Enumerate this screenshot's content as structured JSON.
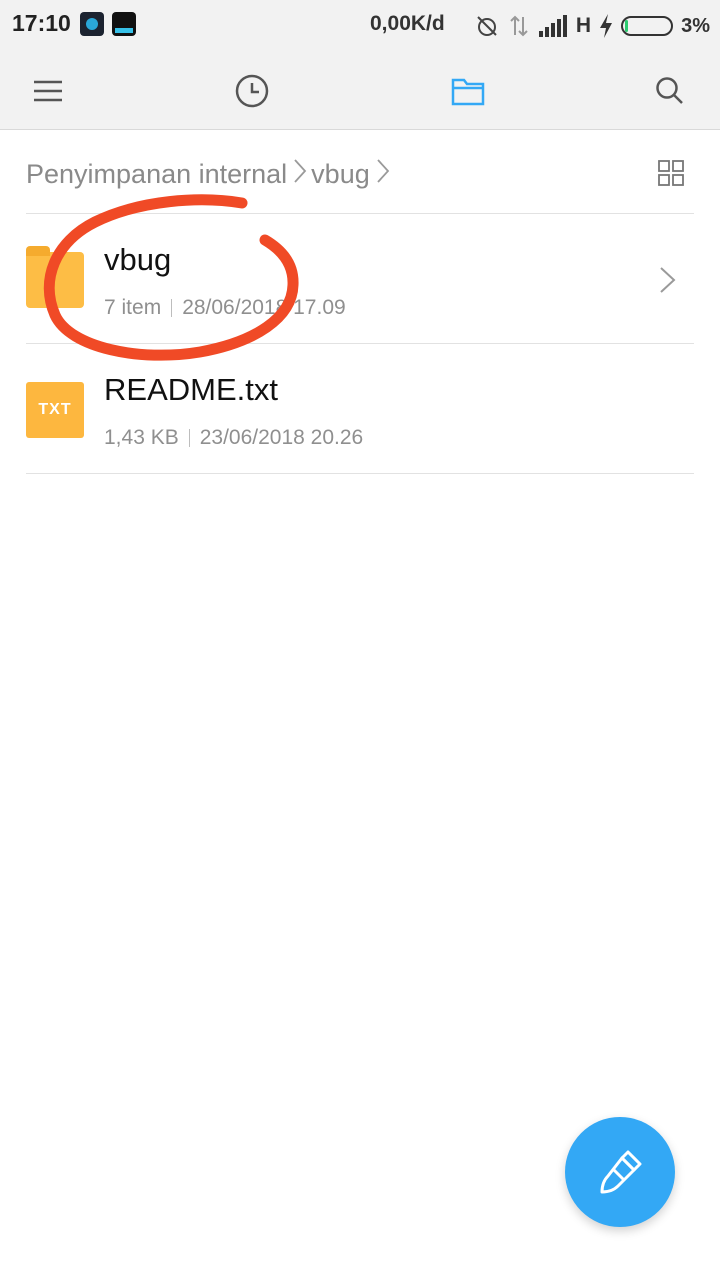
{
  "status_bar": {
    "time": "17:10",
    "network_speed": "0,00K/d",
    "network_type": "H",
    "battery_percent": "3%",
    "battery_level": 0.03,
    "icons": [
      "app-notification-icon",
      "app-notification-icon",
      "alarm-off-icon",
      "data-transfer-icon",
      "signal-icon",
      "charging-icon",
      "battery-icon"
    ]
  },
  "toolbar": {
    "icons": [
      "menu-icon",
      "clock-icon",
      "folder-icon",
      "search-icon"
    ],
    "active": "folder-icon",
    "accent_color": "#33a8f5"
  },
  "breadcrumb": {
    "items": [
      "Penyimpanan internal",
      "vbug"
    ]
  },
  "files": [
    {
      "name": "vbug",
      "type": "folder",
      "count": "7 item",
      "date": "28/06/2018 17.09",
      "icon": "folder-icon"
    },
    {
      "name": "README.txt",
      "type": "file",
      "size": "1,43 KB",
      "date": "23/06/2018 20.26",
      "icon_label": "TXT"
    }
  ],
  "fab": {
    "icon": "brush-icon",
    "color": "#33a8f5"
  },
  "annotation": {
    "color": "#f04a26",
    "shape": "hand-drawn circle"
  }
}
